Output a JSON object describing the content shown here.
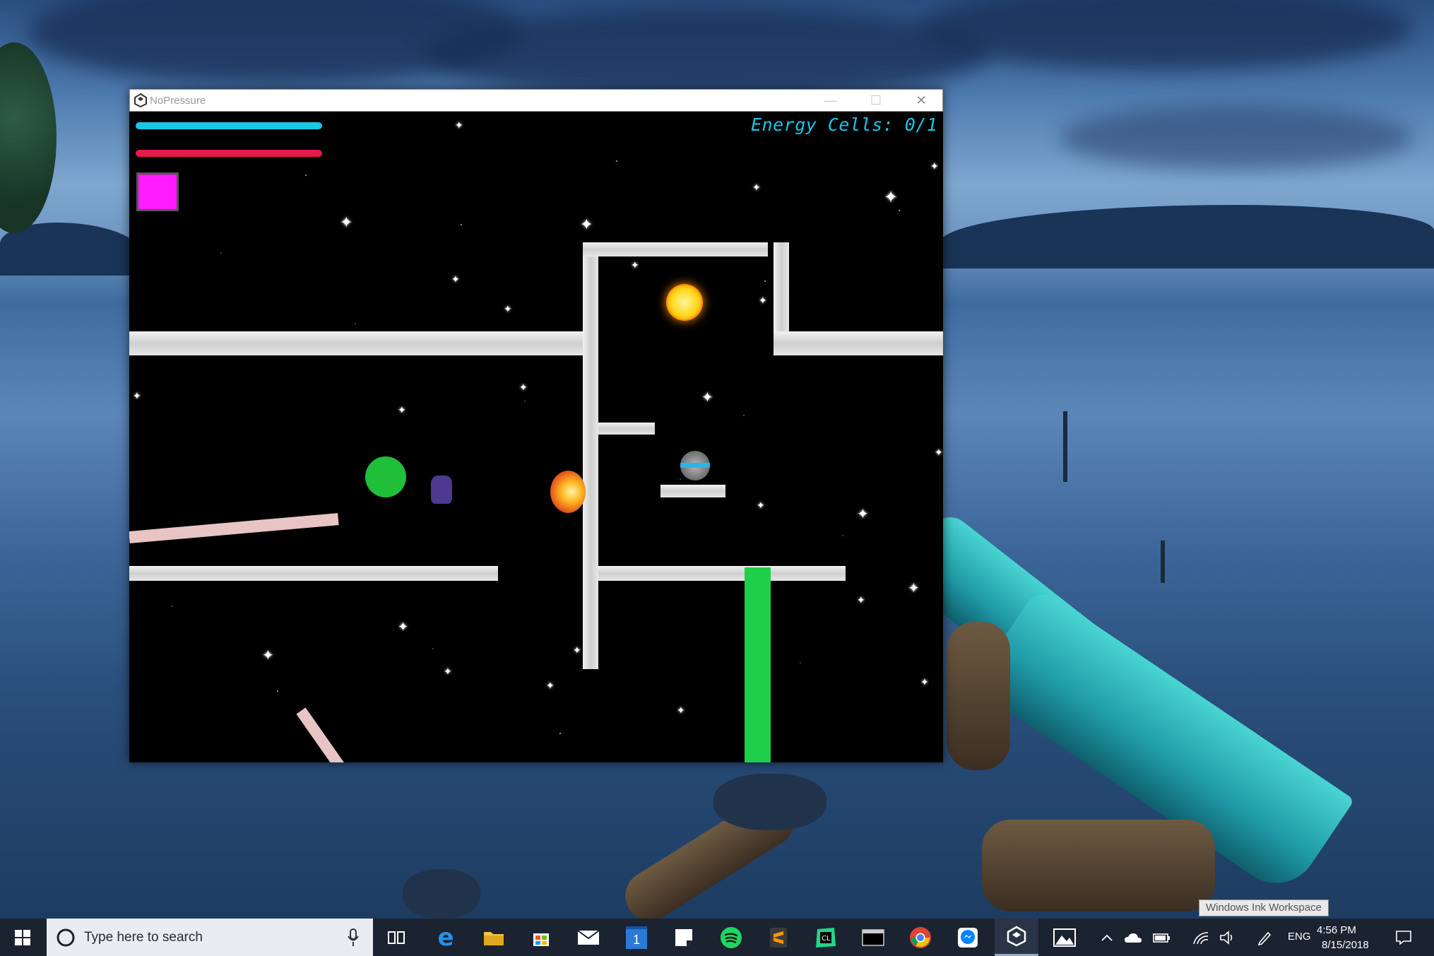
{
  "window": {
    "title": "NoPressure",
    "minimize_glyph": "—",
    "maximize_glyph": "☐",
    "close_glyph": "✕"
  },
  "hud": {
    "energy_cells_text": "Energy Cells: 0/1",
    "energy_bar_color": "#19c6e6",
    "health_bar_color": "#e6194b",
    "item_slot_color": "#ff1aff"
  },
  "game_objects": {
    "sun_color": "#ffd81a",
    "green_orb_color": "#1fbf3a",
    "green_pillar_color": "#1fcf4a",
    "robot_visor_color": "#2fb3e6",
    "pink_ramp_color": "#e8c4c4"
  },
  "taskbar": {
    "search_placeholder": "Type here to search",
    "language": "ENG",
    "time": "4:56 PM",
    "date": "8/15/2018",
    "tooltip": "Windows Ink Workspace",
    "pinned_icons": [
      "task-view-icon",
      "edge-icon",
      "file-explorer-icon",
      "store-icon",
      "mail-icon",
      "calendar-icon",
      "sticky-notes-icon",
      "spotify-icon",
      "sublime-text-icon",
      "clion-icon",
      "terminal-icon",
      "chrome-icon",
      "messenger-icon",
      "unity-icon",
      "photos-icon"
    ],
    "calendar_day": "1"
  }
}
